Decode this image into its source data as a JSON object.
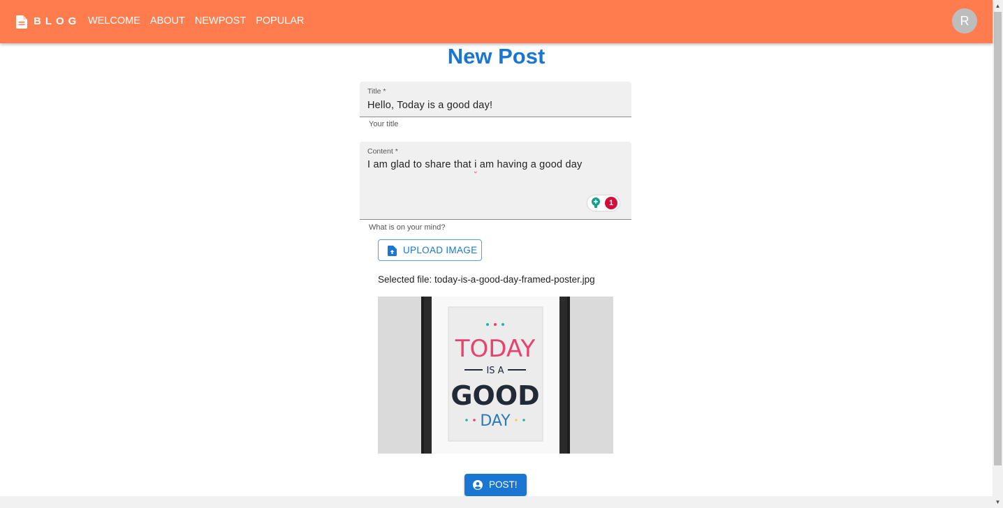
{
  "appbar": {
    "logo_text": "BLOG",
    "logo_icon": "document-icon",
    "nav": [
      "WELCOME",
      "ABOUT",
      "NEWPOST",
      "POPULAR"
    ],
    "avatar_initial": "R",
    "color": "#ff7c4e"
  },
  "page": {
    "title": "New Post"
  },
  "form": {
    "title_field": {
      "label": "Title *",
      "value": "Hello, Today is a good day!",
      "helper": "Your title"
    },
    "content_field": {
      "label": "Content *",
      "value_before": "I am glad to share that ",
      "value_flagged": "i",
      "value_after": " am having a good day",
      "helper": "What is on your mind?"
    },
    "grammar_badge": {
      "count": "1",
      "icon": "lightbulb-icon"
    },
    "upload_button": {
      "label": "UPLOAD IMAGE",
      "icon": "upload-file-icon"
    },
    "selected_file_text": "Selected file: today-is-a-good-day-framed-poster.jpg",
    "poster": {
      "line1": "TODAY",
      "line2": "IS A",
      "line3": "GOOD",
      "line4": "DAY"
    },
    "post_button": {
      "label": "POST!",
      "icon": "account-circle-icon"
    }
  },
  "colors": {
    "accent": "#1976d2",
    "appbar": "#ff7c4e"
  }
}
